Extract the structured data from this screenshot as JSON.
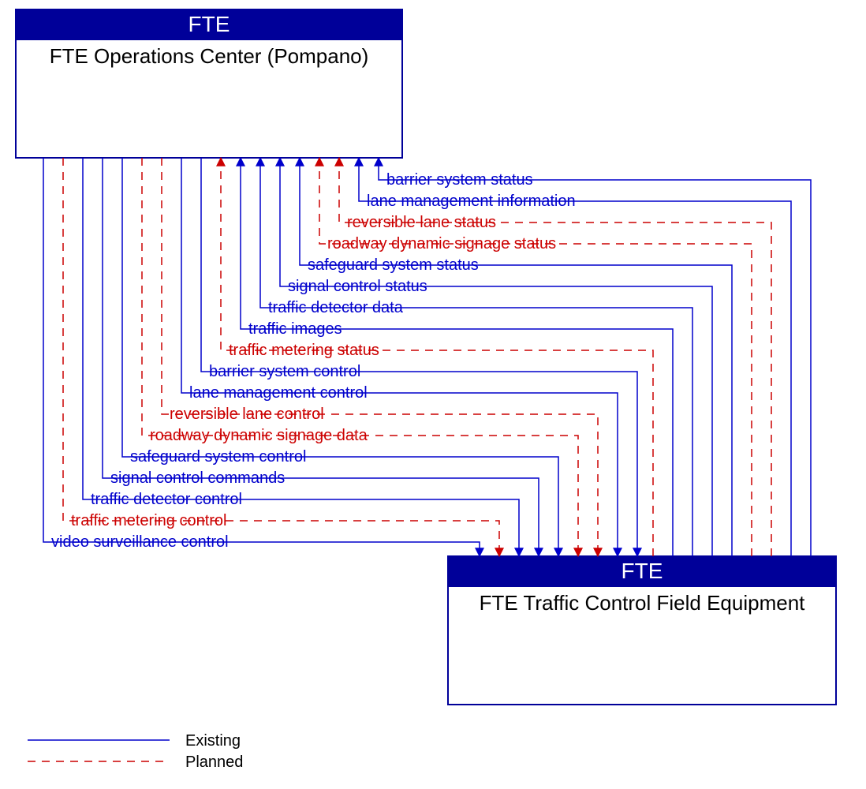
{
  "nodes": {
    "top": {
      "header": "FTE",
      "body": "FTE Operations Center (Pompano)"
    },
    "bottom": {
      "header": "FTE",
      "body": "FTE Traffic Control Field Equipment"
    }
  },
  "flows_incoming": [
    {
      "label": "barrier system status",
      "kind": "existing"
    },
    {
      "label": "lane management information",
      "kind": "existing"
    },
    {
      "label": "reversible lane status",
      "kind": "planned"
    },
    {
      "label": "roadway dynamic signage status",
      "kind": "planned"
    },
    {
      "label": "safeguard system status",
      "kind": "existing"
    },
    {
      "label": "signal control status",
      "kind": "existing"
    },
    {
      "label": "traffic detector data",
      "kind": "existing"
    },
    {
      "label": "traffic images",
      "kind": "existing"
    },
    {
      "label": "traffic metering status",
      "kind": "planned"
    }
  ],
  "flows_outgoing": [
    {
      "label": "barrier system control",
      "kind": "existing"
    },
    {
      "label": "lane management control",
      "kind": "existing"
    },
    {
      "label": "reversible lane control",
      "kind": "planned"
    },
    {
      "label": "roadway dynamic signage data",
      "kind": "planned"
    },
    {
      "label": "safeguard system control",
      "kind": "existing"
    },
    {
      "label": "signal control commands",
      "kind": "existing"
    },
    {
      "label": "traffic detector control",
      "kind": "existing"
    },
    {
      "label": "traffic metering control",
      "kind": "planned"
    },
    {
      "label": "video surveillance control",
      "kind": "existing"
    }
  ],
  "legend": {
    "existing": "Existing",
    "planned": "Planned"
  }
}
